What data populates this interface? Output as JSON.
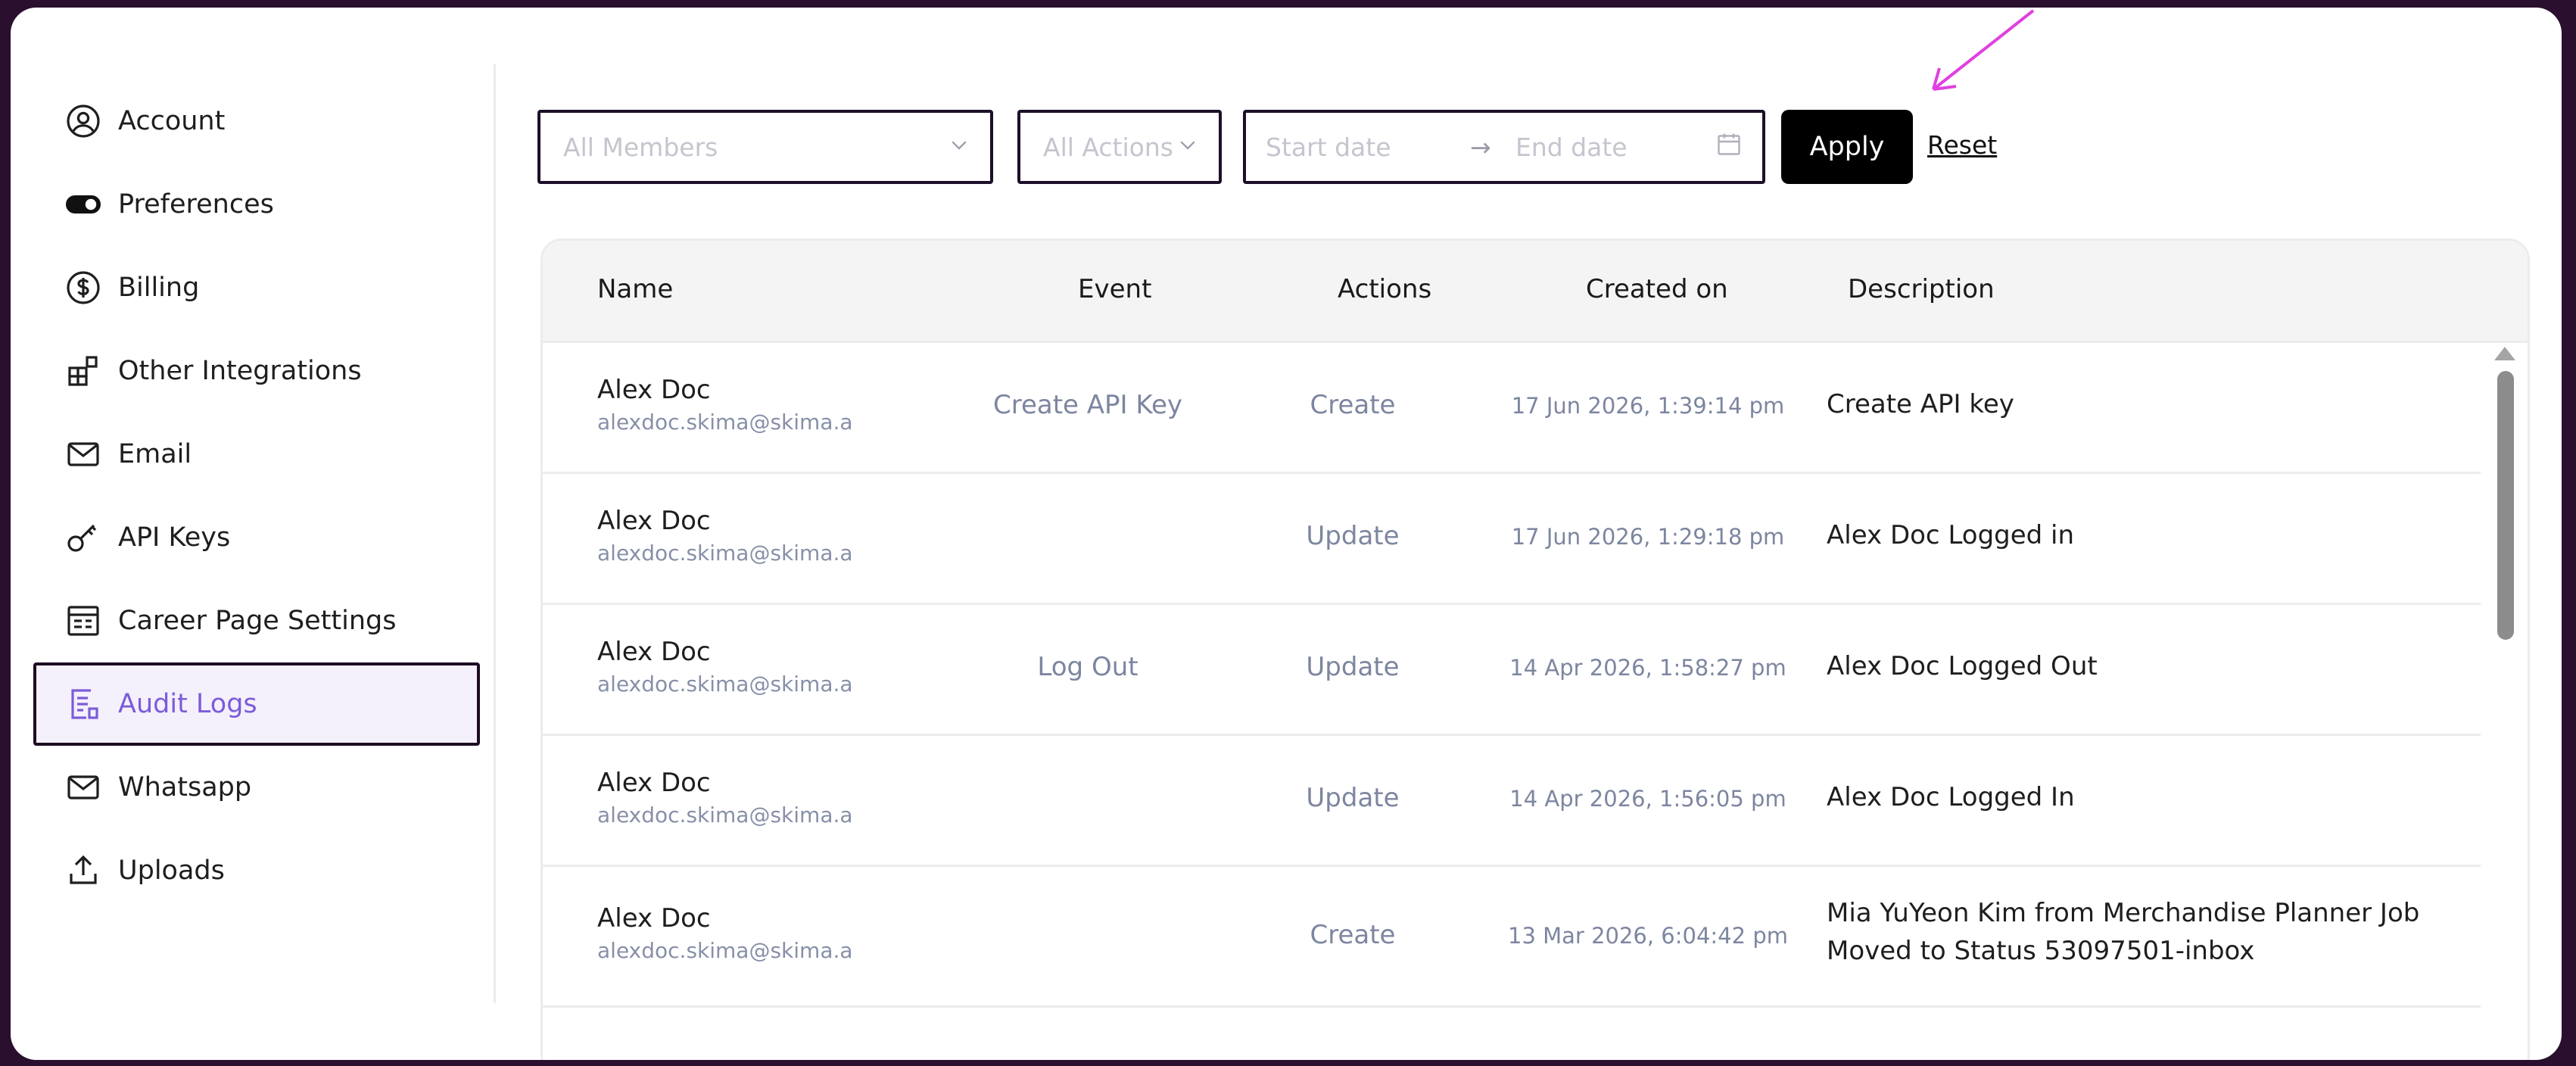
{
  "sidebar": {
    "items": [
      {
        "label": "Account",
        "icon": "user-circle-icon"
      },
      {
        "label": "Preferences",
        "icon": "toggle-icon"
      },
      {
        "label": "Billing",
        "icon": "dollar-circle-icon"
      },
      {
        "label": "Other Integrations",
        "icon": "grid-plus-icon"
      },
      {
        "label": "Email",
        "icon": "mail-icon"
      },
      {
        "label": "API Keys",
        "icon": "key-icon"
      },
      {
        "label": "Career Page Settings",
        "icon": "layout-icon"
      },
      {
        "label": "Audit Logs",
        "icon": "document-icon",
        "active": true
      },
      {
        "label": "Whatsapp",
        "icon": "mail-icon"
      },
      {
        "label": "Uploads",
        "icon": "upload-icon"
      }
    ]
  },
  "filters": {
    "members_placeholder": "All Members",
    "actions_placeholder": "All Actions",
    "start_placeholder": "Start date",
    "arrow": "→",
    "end_placeholder": "End date",
    "apply_label": "Apply",
    "reset_label": "Reset"
  },
  "table": {
    "headers": {
      "name": "Name",
      "event": "Event",
      "actions": "Actions",
      "created": "Created on",
      "description": "Description"
    },
    "rows": [
      {
        "name": "Alex Doc",
        "email": "alexdoc.skima@skima.a",
        "event": "Create API Key",
        "action": "Create",
        "created": "17 Jun 2026, 1:39:14 pm",
        "description": "Create API key",
        "description2": ""
      },
      {
        "name": "Alex Doc",
        "email": "alexdoc.skima@skima.a",
        "event": "",
        "action": "Update",
        "created": "17 Jun 2026, 1:29:18 pm",
        "description": "Alex Doc Logged in",
        "description2": ""
      },
      {
        "name": "Alex Doc",
        "email": "alexdoc.skima@skima.a",
        "event": "Log Out",
        "action": "Update",
        "created": "14 Apr 2026, 1:58:27 pm",
        "description": "Alex Doc Logged Out",
        "description2": ""
      },
      {
        "name": "Alex Doc",
        "email": "alexdoc.skima@skima.a",
        "event": "",
        "action": "Update",
        "created": "14 Apr 2026, 1:56:05 pm",
        "description": "Alex Doc Logged In",
        "description2": ""
      },
      {
        "name": "Alex Doc",
        "email": "alexdoc.skima@skima.a",
        "event": "",
        "action": "Create",
        "created": "13 Mar 2026, 6:04:42 pm",
        "description": "Mia YuYeon Kim from Merchandise Planner Job",
        "description2": "Moved to Status 53097501-inbox"
      }
    ]
  },
  "colors": {
    "accent": "#7c5cd8",
    "annotation": "#e040e0",
    "frame": "#2a0f2e"
  }
}
